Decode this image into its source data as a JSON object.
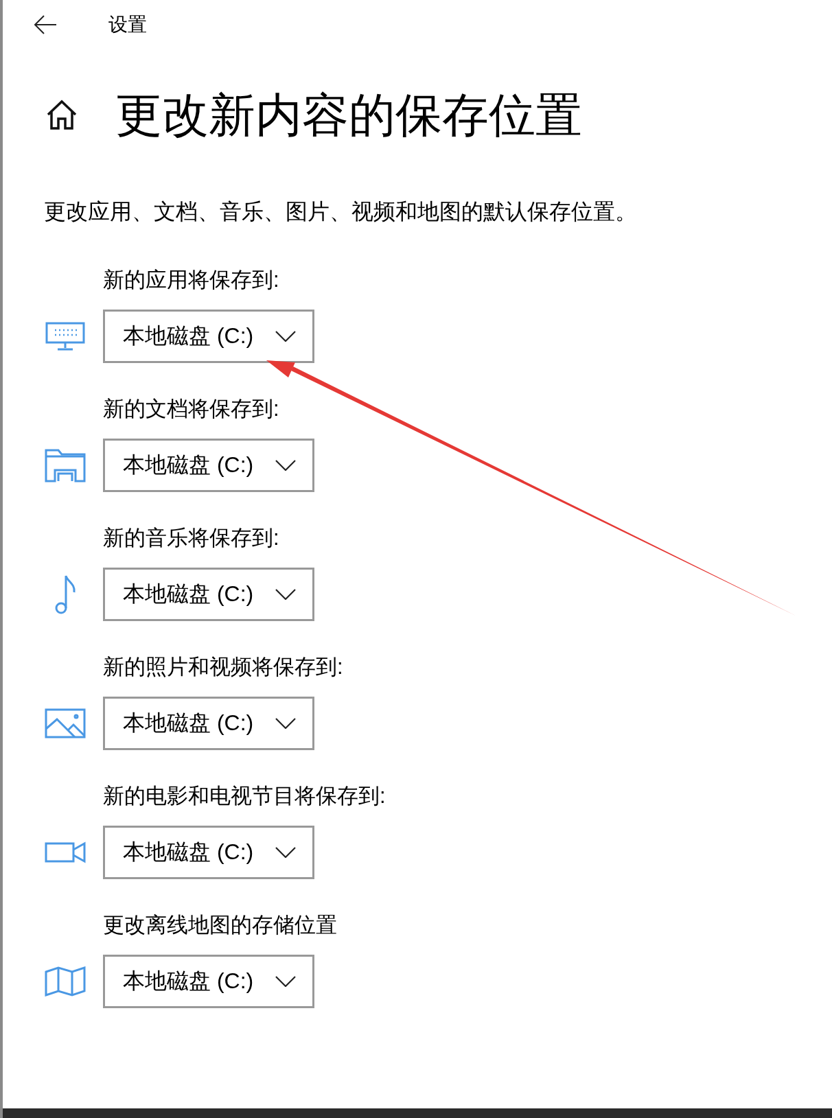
{
  "window": {
    "title": "设置"
  },
  "page_title": "更改新内容的保存位置",
  "description": "更改应用、文档、音乐、图片、视频和地图的默认保存位置。",
  "locations": [
    {
      "label": "新的应用将保存到:",
      "kind": "apps",
      "value": "本地磁盘 (C:)"
    },
    {
      "label": "新的文档将保存到:",
      "kind": "documents",
      "value": "本地磁盘 (C:)"
    },
    {
      "label": "新的音乐将保存到:",
      "kind": "music",
      "value": "本地磁盘 (C:)"
    },
    {
      "label": "新的照片和视频将保存到:",
      "kind": "photos",
      "value": "本地磁盘 (C:)"
    },
    {
      "label": "新的电影和电视节目将保存到:",
      "kind": "movies",
      "value": "本地磁盘 (C:)"
    },
    {
      "label": "更改离线地图的存储位置",
      "kind": "maps",
      "value": "本地磁盘 (C:)"
    }
  ]
}
